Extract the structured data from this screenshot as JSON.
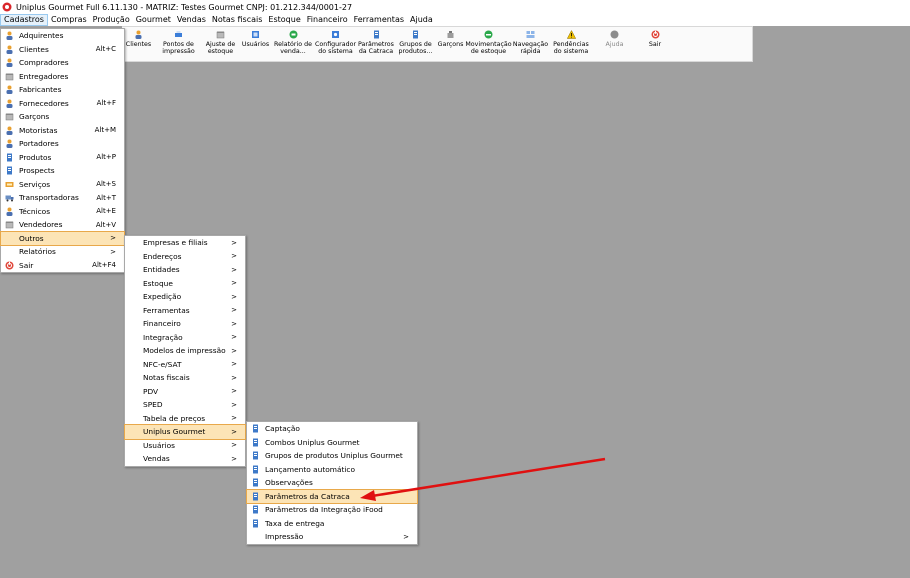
{
  "window": {
    "title": "Uniplus Gourmet Full 6.11.130 - MATRIZ: Testes Gourmet CNPJ: 01.212.344/0001-27"
  },
  "menubar": [
    "Cadastros",
    "Compras",
    "Produção",
    "Gourmet",
    "Vendas",
    "Notas fiscais",
    "Estoque",
    "Financeiro",
    "Ferramentas",
    "Ajuda"
  ],
  "toolbar": [
    {
      "label": "Clientes",
      "icon": "person-icon"
    },
    {
      "label": "Pontos de\nimpressão",
      "icon": "printer-icon"
    },
    {
      "label": "Ajuste de\nestoque",
      "icon": "box-icon"
    },
    {
      "label": "Usuários",
      "icon": "users-icon"
    },
    {
      "label": "Relatório de\nvenda...",
      "icon": "report-icon"
    },
    {
      "label": "Configurador\ndo sistema",
      "icon": "config-icon"
    },
    {
      "label": "Parâmetros\nda Catraca",
      "icon": "doc-icon"
    },
    {
      "label": "Grupos de\nprodutos...",
      "icon": "doc-icon"
    },
    {
      "label": "Garçons",
      "icon": "waiter-icon"
    },
    {
      "label": "Movimentação\nde estoque",
      "icon": "stock-icon"
    },
    {
      "label": "Navegação\nrápida",
      "icon": "nav-icon"
    },
    {
      "label": "Pendências\ndo sistema",
      "icon": "warning-icon"
    },
    {
      "label": "Ajuda",
      "icon": "help-icon",
      "disabled": true
    },
    {
      "label": "Sair",
      "icon": "exit-icon"
    }
  ],
  "cadastros_menu": [
    {
      "label": "Adquirentes",
      "shortcut": "",
      "icon": "person-icon"
    },
    {
      "label": "Clientes",
      "shortcut": "Alt+C",
      "icon": "person-icon"
    },
    {
      "label": "Compradores",
      "shortcut": "",
      "icon": "person-icon"
    },
    {
      "label": "Entregadores",
      "shortcut": "",
      "icon": "box-icon"
    },
    {
      "label": "Fabricantes",
      "shortcut": "",
      "icon": "person-icon"
    },
    {
      "label": "Fornecedores",
      "shortcut": "Alt+F",
      "icon": "person-icon"
    },
    {
      "label": "Garçons",
      "shortcut": "",
      "icon": "box-icon"
    },
    {
      "label": "Motoristas",
      "shortcut": "Alt+M",
      "icon": "person-icon"
    },
    {
      "label": "Portadores",
      "shortcut": "",
      "icon": "person-icon"
    },
    {
      "label": "Produtos",
      "shortcut": "Alt+P",
      "icon": "doc-icon"
    },
    {
      "label": "Prospects",
      "shortcut": "",
      "icon": "doc-icon"
    },
    {
      "label": "Serviços",
      "shortcut": "Alt+S",
      "icon": "service-icon"
    },
    {
      "label": "Transportadoras",
      "shortcut": "Alt+T",
      "icon": "truck-icon"
    },
    {
      "label": "Técnicos",
      "shortcut": "Alt+E",
      "icon": "person-icon"
    },
    {
      "label": "Vendedores",
      "shortcut": "Alt+V",
      "icon": "box-icon"
    },
    {
      "label": "Outros",
      "shortcut": "",
      "submenu": true,
      "highlighted": true
    },
    {
      "label": "Relatórios",
      "shortcut": "",
      "submenu": true
    },
    {
      "label": "Sair",
      "shortcut": "Alt+F4",
      "icon": "exit-icon"
    }
  ],
  "outros_menu": [
    {
      "label": "Empresas e filiais"
    },
    {
      "label": "Endereços"
    },
    {
      "label": "Entidades"
    },
    {
      "label": "Estoque"
    },
    {
      "label": "Expedição"
    },
    {
      "label": "Ferramentas"
    },
    {
      "label": "Financeiro"
    },
    {
      "label": "Integração"
    },
    {
      "label": "Modelos de impressão"
    },
    {
      "label": "NFC-e/SAT"
    },
    {
      "label": "Notas fiscais"
    },
    {
      "label": "PDV"
    },
    {
      "label": "SPED"
    },
    {
      "label": "Tabela de preços"
    },
    {
      "label": "Uniplus Gourmet",
      "highlighted": true
    },
    {
      "label": "Usuários"
    },
    {
      "label": "Vendas"
    }
  ],
  "gourmet_menu": [
    {
      "label": "Captação",
      "icon": "doc-icon"
    },
    {
      "label": "Combos Uniplus Gourmet",
      "icon": "doc-icon"
    },
    {
      "label": "Grupos de produtos Uniplus Gourmet",
      "icon": "doc-icon"
    },
    {
      "label": "Lançamento automático",
      "icon": "doc-icon"
    },
    {
      "label": "Observações",
      "icon": "doc-icon"
    },
    {
      "label": "Parâmetros da Catraca",
      "icon": "doc-icon",
      "highlighted": true
    },
    {
      "label": "Parâmetros da Integração iFood",
      "icon": "doc-icon"
    },
    {
      "label": "Taxa de entrega",
      "icon": "doc-icon"
    },
    {
      "label": "Impressão",
      "submenu": true
    }
  ],
  "colors": {
    "background": "#a0a0a0",
    "highlight": "#fce4b6",
    "arrow": "#e01010"
  }
}
